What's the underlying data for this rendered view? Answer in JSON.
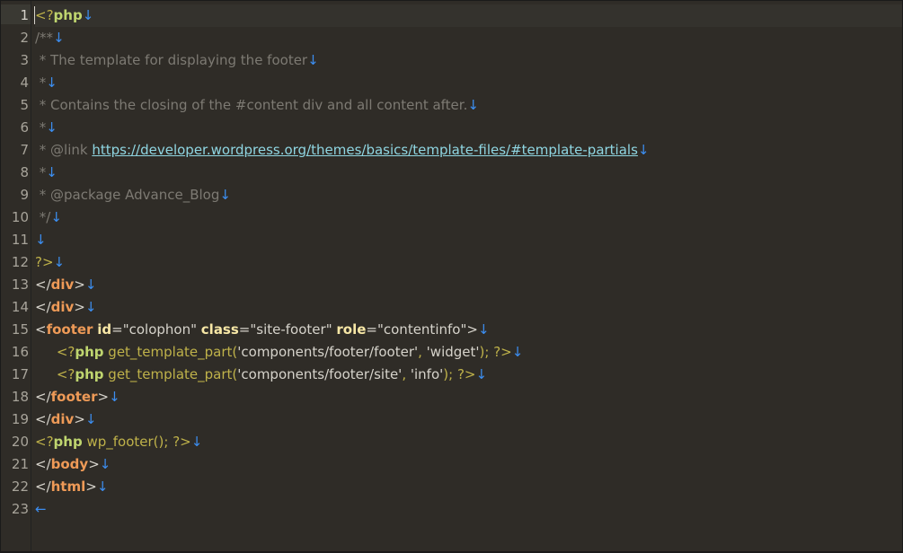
{
  "colors": {
    "background": "#2f2c27",
    "php_tag": "#bfb24a",
    "php_keyword": "#bfd56f",
    "comment": "#7d7a73",
    "link": "#8fd6e2",
    "html_tag": "#ee9a57",
    "attribute": "#f7e7a6",
    "newline_marker": "#3c8ef0"
  },
  "editor": {
    "active_line": 1,
    "newline_marker": "↓",
    "eof_marker": "←",
    "line_numbers": [
      "1",
      "2",
      "3",
      "4",
      "5",
      "6",
      "7",
      "8",
      "9",
      "10",
      "11",
      "12",
      "13",
      "14",
      "15",
      "16",
      "17",
      "18",
      "19",
      "20",
      "21",
      "22",
      "23"
    ],
    "lines": [
      {
        "tokens": [
          {
            "t": "pt",
            "v": "<?"
          },
          {
            "t": "ph",
            "v": "php"
          },
          {
            "t": "nl",
            "v": "↓"
          }
        ]
      },
      {
        "tokens": [
          {
            "t": "cm",
            "v": "/**"
          },
          {
            "t": "nl",
            "v": "↓"
          }
        ]
      },
      {
        "tokens": [
          {
            "t": "cm",
            "v": " * The template for displaying the footer"
          },
          {
            "t": "nl",
            "v": "↓"
          }
        ]
      },
      {
        "tokens": [
          {
            "t": "cm",
            "v": " *"
          },
          {
            "t": "nl",
            "v": "↓"
          }
        ]
      },
      {
        "tokens": [
          {
            "t": "cm",
            "v": " * Contains the closing of the #content div and all content after."
          },
          {
            "t": "nl",
            "v": "↓"
          }
        ]
      },
      {
        "tokens": [
          {
            "t": "cm",
            "v": " *"
          },
          {
            "t": "nl",
            "v": "↓"
          }
        ]
      },
      {
        "tokens": [
          {
            "t": "cm",
            "v": " * @link "
          },
          {
            "t": "ur",
            "v": "https://developer.wordpress.org/themes/basics/template-files/#template-partials"
          },
          {
            "t": "nl",
            "v": "↓"
          }
        ]
      },
      {
        "tokens": [
          {
            "t": "cm",
            "v": " *"
          },
          {
            "t": "nl",
            "v": "↓"
          }
        ]
      },
      {
        "tokens": [
          {
            "t": "cm",
            "v": " * @package Advance_Blog"
          },
          {
            "t": "nl",
            "v": "↓"
          }
        ]
      },
      {
        "tokens": [
          {
            "t": "cm",
            "v": " */"
          },
          {
            "t": "nl",
            "v": "↓"
          }
        ]
      },
      {
        "tokens": [
          {
            "t": "nl",
            "v": "↓"
          }
        ]
      },
      {
        "tokens": [
          {
            "t": "pt",
            "v": "?>"
          },
          {
            "t": "nl",
            "v": "↓"
          }
        ]
      },
      {
        "tokens": [
          {
            "t": "op",
            "v": "</"
          },
          {
            "t": "tg",
            "v": "div"
          },
          {
            "t": "op",
            "v": ">"
          },
          {
            "t": "nl",
            "v": "↓"
          }
        ]
      },
      {
        "tokens": [
          {
            "t": "op",
            "v": "</"
          },
          {
            "t": "tg",
            "v": "div"
          },
          {
            "t": "op",
            "v": ">"
          },
          {
            "t": "nl",
            "v": "↓"
          }
        ]
      },
      {
        "tokens": [
          {
            "t": "op",
            "v": "<"
          },
          {
            "t": "tg",
            "v": "footer"
          },
          {
            "t": "op",
            "v": " "
          },
          {
            "t": "at",
            "v": "id"
          },
          {
            "t": "op",
            "v": "="
          },
          {
            "t": "sv",
            "v": "\"colophon\""
          },
          {
            "t": "op",
            "v": " "
          },
          {
            "t": "at",
            "v": "class"
          },
          {
            "t": "op",
            "v": "="
          },
          {
            "t": "sv",
            "v": "\"site-footer\""
          },
          {
            "t": "op",
            "v": " "
          },
          {
            "t": "at",
            "v": "role"
          },
          {
            "t": "op",
            "v": "="
          },
          {
            "t": "sv",
            "v": "\"contentinfo\""
          },
          {
            "t": "op",
            "v": ">"
          },
          {
            "t": "nl",
            "v": "↓"
          }
        ]
      },
      {
        "tokens": [
          {
            "t": "op",
            "v": "     "
          },
          {
            "t": "pt",
            "v": "<?"
          },
          {
            "t": "ph",
            "v": "php"
          },
          {
            "t": "fn",
            "v": " get_template_part("
          },
          {
            "t": "sv",
            "v": "'components/footer/footer'"
          },
          {
            "t": "fn",
            "v": ", "
          },
          {
            "t": "sv",
            "v": "'widget'"
          },
          {
            "t": "fn",
            "v": "); "
          },
          {
            "t": "pt",
            "v": "?>"
          },
          {
            "t": "nl",
            "v": "↓"
          }
        ]
      },
      {
        "tokens": [
          {
            "t": "op",
            "v": "     "
          },
          {
            "t": "pt",
            "v": "<?"
          },
          {
            "t": "ph",
            "v": "php"
          },
          {
            "t": "fn",
            "v": " get_template_part("
          },
          {
            "t": "sv",
            "v": "'components/footer/site'"
          },
          {
            "t": "fn",
            "v": ", "
          },
          {
            "t": "sv",
            "v": "'info'"
          },
          {
            "t": "fn",
            "v": "); "
          },
          {
            "t": "pt",
            "v": "?>"
          },
          {
            "t": "nl",
            "v": "↓"
          }
        ]
      },
      {
        "tokens": [
          {
            "t": "op",
            "v": "</"
          },
          {
            "t": "tg",
            "v": "footer"
          },
          {
            "t": "op",
            "v": ">"
          },
          {
            "t": "nl",
            "v": "↓"
          }
        ]
      },
      {
        "tokens": [
          {
            "t": "op",
            "v": "</"
          },
          {
            "t": "tg",
            "v": "div"
          },
          {
            "t": "op",
            "v": ">"
          },
          {
            "t": "nl",
            "v": "↓"
          }
        ]
      },
      {
        "tokens": [
          {
            "t": "pt",
            "v": "<?"
          },
          {
            "t": "ph",
            "v": "php"
          },
          {
            "t": "fn",
            "v": " wp_footer(); "
          },
          {
            "t": "pt",
            "v": "?>"
          },
          {
            "t": "nl",
            "v": "↓"
          }
        ]
      },
      {
        "tokens": [
          {
            "t": "op",
            "v": "</"
          },
          {
            "t": "tg",
            "v": "body"
          },
          {
            "t": "op",
            "v": ">"
          },
          {
            "t": "nl",
            "v": "↓"
          }
        ]
      },
      {
        "tokens": [
          {
            "t": "op",
            "v": "</"
          },
          {
            "t": "tg",
            "v": "html"
          },
          {
            "t": "op",
            "v": ">"
          },
          {
            "t": "nl",
            "v": "↓"
          }
        ]
      },
      {
        "tokens": [
          {
            "t": "nl",
            "v": "←"
          }
        ]
      }
    ]
  }
}
